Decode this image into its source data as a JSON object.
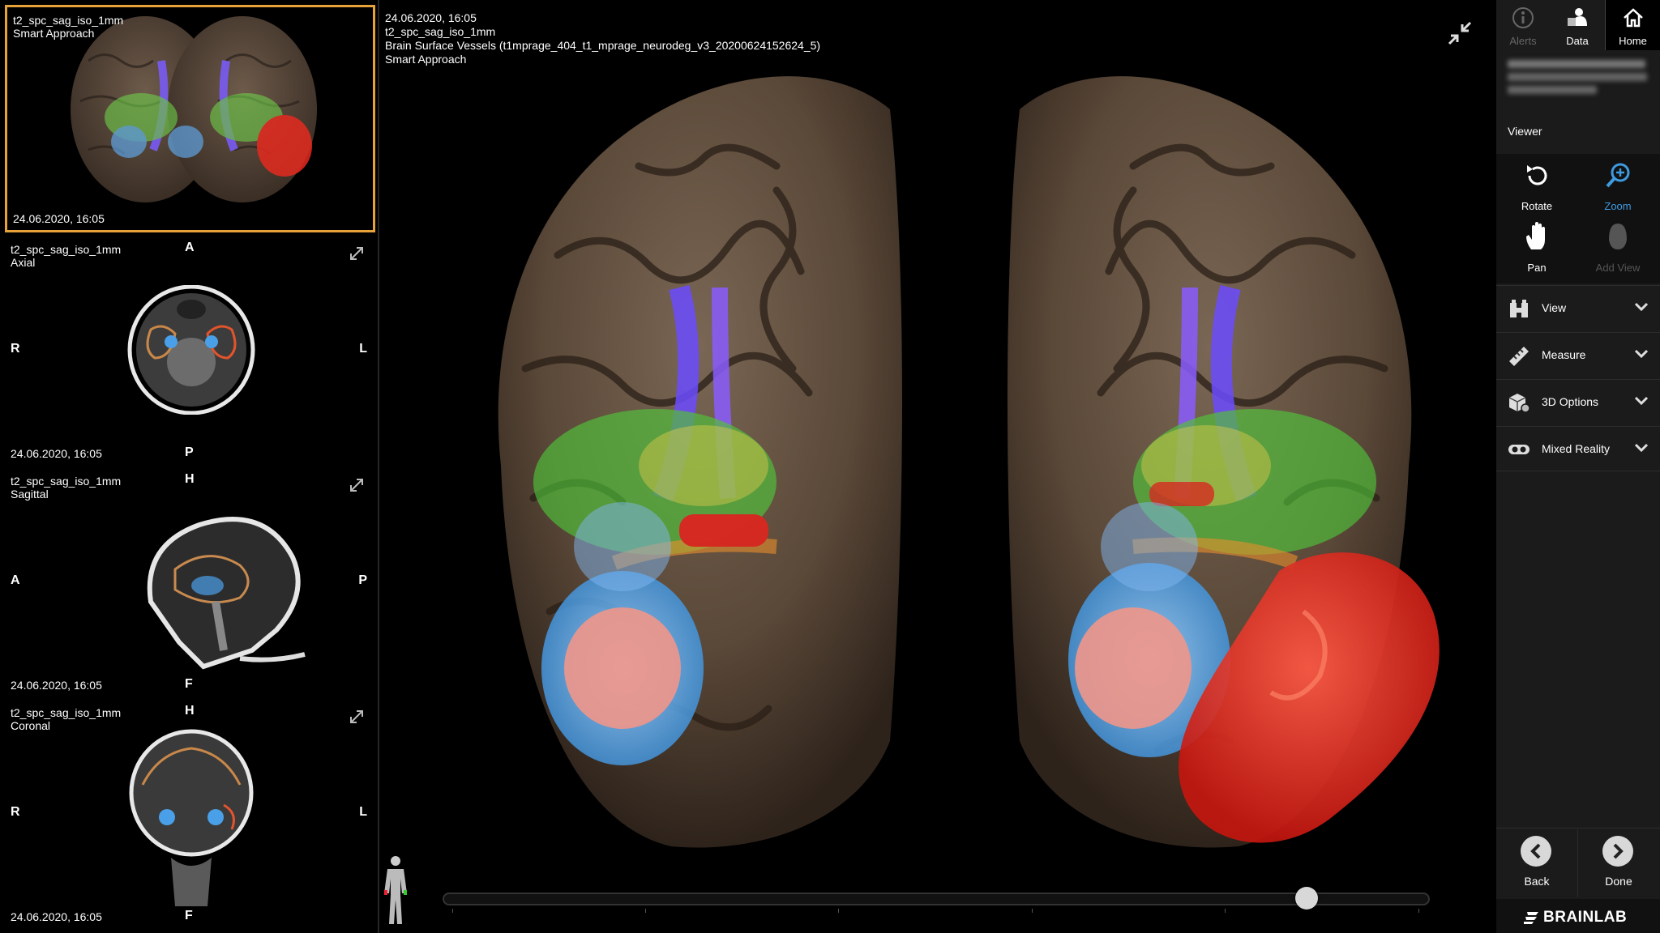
{
  "thumbnails": [
    {
      "name": "t2_spc_sag_iso_1mm",
      "sub": "Smart Approach",
      "date": "24.06.2020, 16:05"
    },
    {
      "name": "t2_spc_sag_iso_1mm",
      "sub": "Axial",
      "date": "24.06.2020, 16:05",
      "top": "A",
      "bottom": "P",
      "left": "R",
      "right": "L"
    },
    {
      "name": "t2_spc_sag_iso_1mm",
      "sub": "Sagittal",
      "date": "24.06.2020, 16:05",
      "top": "H",
      "bottom": "F",
      "left": "A",
      "right": "P"
    },
    {
      "name": "t2_spc_sag_iso_1mm",
      "sub": "Coronal",
      "date": "24.06.2020, 16:05",
      "top": "H",
      "bottom": "F",
      "left": "R",
      "right": "L"
    }
  ],
  "viewer": {
    "date": "24.06.2020, 16:05",
    "series": "t2_spc_sag_iso_1mm",
    "description": "Brain Surface Vessels (t1mprage_404_t1_mprage_neurodeg_v3_20200624152624_5)",
    "mode": "Smart Approach",
    "slider_position": 0.885
  },
  "panel": {
    "tabs": [
      {
        "label": "Alerts",
        "icon": "info-icon",
        "enabled": false
      },
      {
        "label": "Data",
        "icon": "patient-data-icon",
        "enabled": true
      },
      {
        "label": "Home",
        "icon": "home-icon",
        "enabled": true
      }
    ],
    "section_title": "Viewer",
    "tools": [
      {
        "label": "Rotate",
        "icon": "rotate-icon"
      },
      {
        "label": "Zoom",
        "icon": "zoom-icon",
        "active": true
      },
      {
        "label": "Pan",
        "icon": "hand-icon"
      },
      {
        "label": "Add View",
        "icon": "add-view-icon",
        "enabled": false
      }
    ],
    "accordions": [
      {
        "label": "View",
        "icon": "binoculars-icon"
      },
      {
        "label": "Measure",
        "icon": "ruler-icon"
      },
      {
        "label": "3D Options",
        "icon": "cube-icon"
      },
      {
        "label": "Mixed Reality",
        "icon": "vr-headset-icon"
      }
    ],
    "back_label": "Back",
    "done_label": "Done",
    "brand": "BRAINLAB"
  },
  "colors": {
    "selected_border": "#e7a33a",
    "accent": "#3f9be0",
    "panel_bg": "#1b1b1b"
  }
}
